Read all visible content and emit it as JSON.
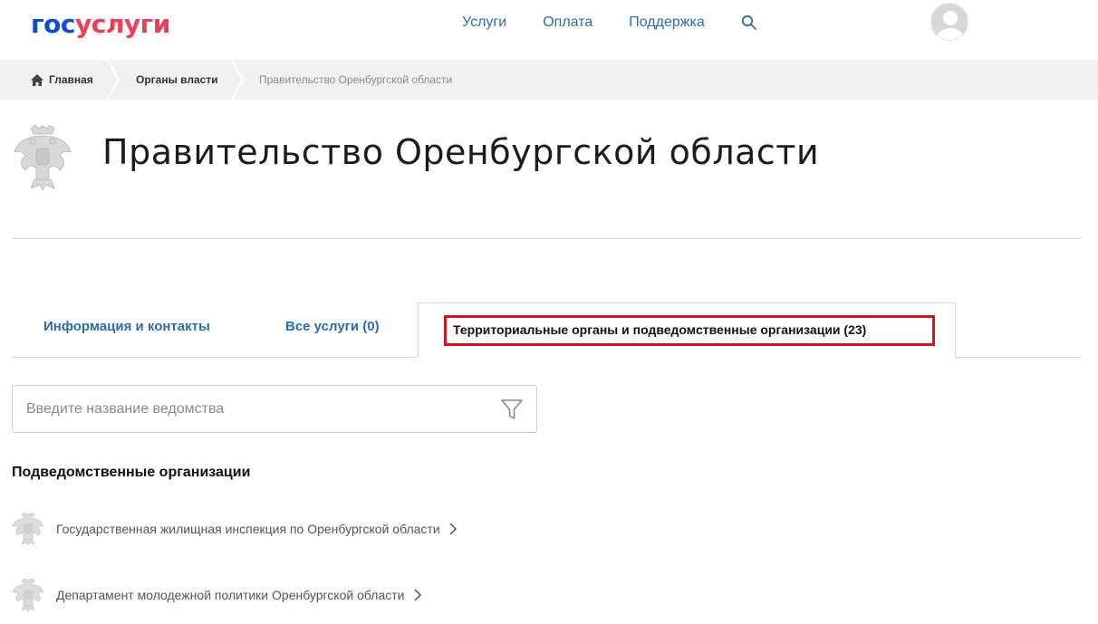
{
  "header": {
    "logo_part1": "гос",
    "logo_part2": "услуги",
    "nav": [
      "Услуги",
      "Оплата",
      "Поддержка"
    ]
  },
  "breadcrumb": {
    "home": "Главная",
    "organs": "Органы власти",
    "current": "Правительство Оренбургской области"
  },
  "page": {
    "title": "Правительство Оренбургской области"
  },
  "tabs": {
    "info": "Информация и контакты",
    "all_services": "Все услуги (0)",
    "territorial": "Территориальные органы и подведомственные организации (23)"
  },
  "filter": {
    "placeholder": "Введите название ведомства"
  },
  "subordinate": {
    "title": "Подведомственные организации",
    "items": [
      "Государственная жилищная инспекция по Оренбургской области",
      "Департамент молодежной политики Оренбургской области"
    ]
  },
  "colors": {
    "brand_blue": "#0d4cd3",
    "brand_red": "#ee3f58",
    "link_blue": "#2c6da8",
    "highlight_red": "#d3141c"
  }
}
